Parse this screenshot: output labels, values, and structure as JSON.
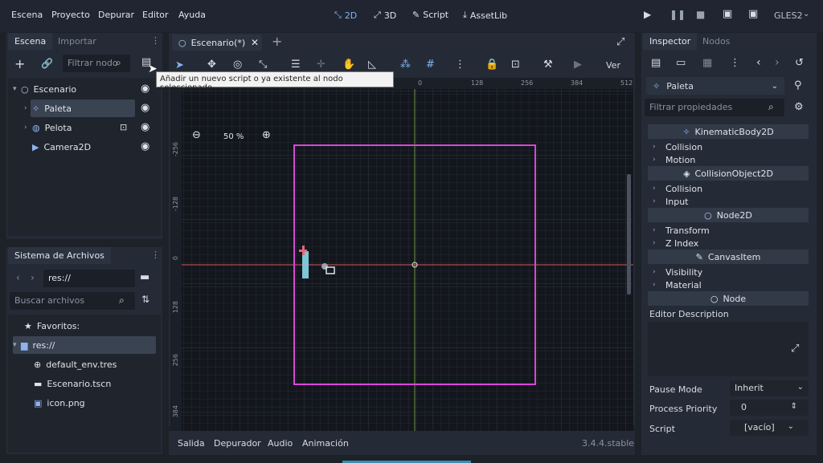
{
  "menubar": {
    "items": [
      "Escena",
      "Proyecto",
      "Depurar",
      "Editor",
      "Ayuda"
    ],
    "modes": [
      {
        "label": "2D",
        "icon": "2d-icon",
        "active": true
      },
      {
        "label": "3D",
        "icon": "3d-icon",
        "active": false
      },
      {
        "label": "Script",
        "icon": "script-icon",
        "active": false
      },
      {
        "label": "AssetLib",
        "icon": "assetlib-icon",
        "active": false
      }
    ],
    "renderer": "GLES2"
  },
  "scene_dock": {
    "tabs": [
      "Escena",
      "Importar"
    ],
    "filter_placeholder": "Filtrar nodo",
    "tooltip": "Añadir un nuevo script o ya existente al nodo seleccionado.",
    "tree": [
      {
        "name": "Escenario",
        "icon": "node2d-icon",
        "depth": 0
      },
      {
        "name": "Paleta",
        "icon": "kinematic-body-icon",
        "depth": 1,
        "selected": true
      },
      {
        "name": "Pelota",
        "icon": "rigid-body-icon",
        "depth": 1
      },
      {
        "name": "Camera2D",
        "icon": "camera-icon",
        "depth": 1
      }
    ]
  },
  "filesystem_dock": {
    "title": "Sistema de Archivos",
    "path": "res://",
    "search_placeholder": "Buscar archivos",
    "tree": [
      {
        "name": "Favoritos:",
        "icon": "star-icon"
      },
      {
        "name": "res://",
        "icon": "folder-icon",
        "selected": true
      },
      {
        "name": "default_env.tres",
        "icon": "globe-icon"
      },
      {
        "name": "Escenario.tscn",
        "icon": "clapper-icon"
      },
      {
        "name": "icon.png",
        "icon": "image-icon"
      }
    ]
  },
  "viewport": {
    "tab_label": "Escenario(*)",
    "zoom": "50 %",
    "view_label": "Ver",
    "ruler_top": [
      "0",
      "128",
      "256",
      "384",
      "512"
    ],
    "ruler_left": [
      "-256",
      "-128",
      "0",
      "128",
      "256",
      "384"
    ]
  },
  "bottom_panel": {
    "tabs": [
      "Salida",
      "Depurador",
      "Audio",
      "Animación"
    ],
    "version": "3.4.4.stable"
  },
  "inspector": {
    "tabs": [
      "Inspector",
      "Nodos"
    ],
    "node_name": "Paleta",
    "filter_placeholder": "Filtrar propiedades",
    "sections": [
      {
        "header": "KinematicBody2D",
        "icon": "kinematic-body-icon",
        "props": [
          "Collision",
          "Motion"
        ]
      },
      {
        "header": "CollisionObject2D",
        "icon": "cube-icon",
        "props": [
          "Collision",
          "Input"
        ]
      },
      {
        "header": "Node2D",
        "icon": "circle-icon",
        "props": [
          "Transform",
          "Z Index"
        ]
      },
      {
        "header": "CanvasItem",
        "icon": "brush-icon",
        "props": [
          "Visibility",
          "Material"
        ]
      },
      {
        "header": "Node",
        "icon": "circle-icon",
        "props": []
      }
    ],
    "editor_description_label": "Editor Description",
    "pause_mode_label": "Pause Mode",
    "pause_mode_value": "Inherit",
    "process_priority_label": "Process Priority",
    "process_priority_value": "0",
    "script_label": "Script",
    "script_value": "[vacío]"
  },
  "colors": {
    "accent": "#7fb4f7",
    "camera_rect": "#d946d9",
    "axis_x": "#d05a5a",
    "axis_y": "#9acb56"
  }
}
